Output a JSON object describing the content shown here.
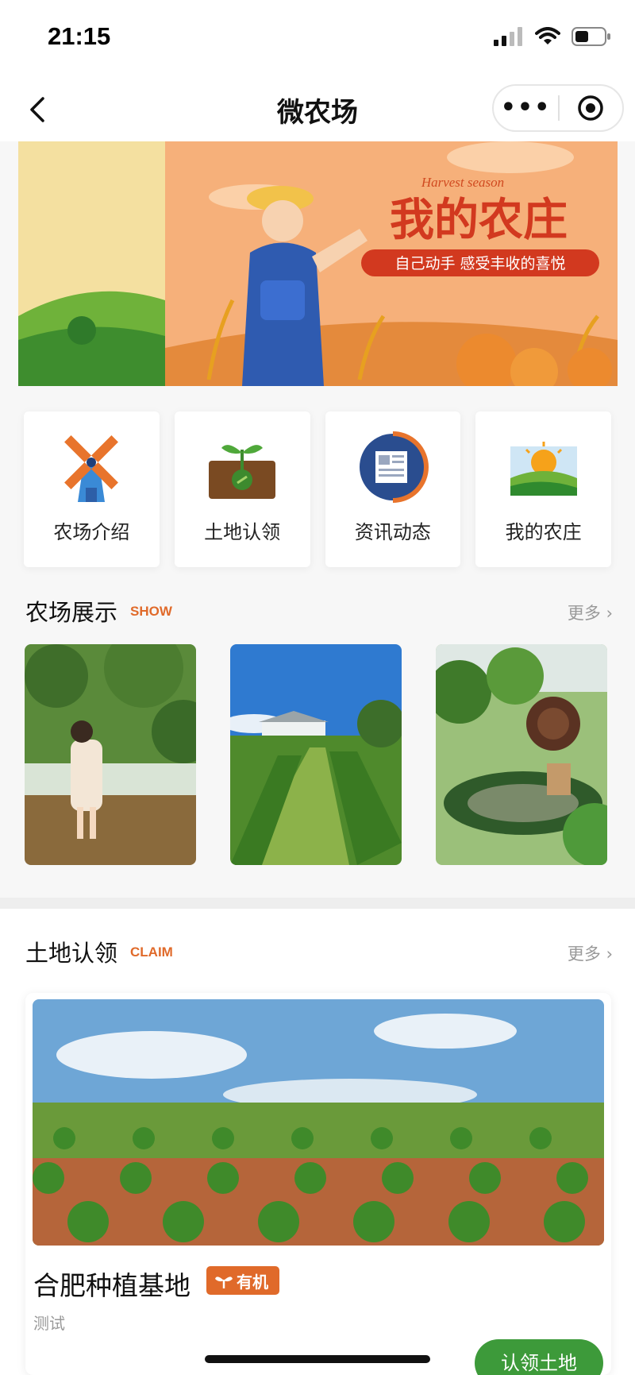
{
  "status_bar": {
    "time": "21:15"
  },
  "navbar": {
    "title": "微农场"
  },
  "banner": {
    "headline": "我的农庄",
    "script_text": "Harvest season",
    "slogan": "自己动手 感受丰收的喜悦"
  },
  "quick_menu": [
    {
      "label": "农场介绍",
      "icon": "windmill-icon"
    },
    {
      "label": "土地认领",
      "icon": "sprout-icon"
    },
    {
      "label": "资讯动态",
      "icon": "news-icon"
    },
    {
      "label": "我的农庄",
      "icon": "sunrise-field-icon"
    }
  ],
  "show_section": {
    "title": "农场展示",
    "tag": "SHOW",
    "more": "更多"
  },
  "claim_section": {
    "title": "土地认领",
    "tag": "CLAIM",
    "more": "更多"
  },
  "land_item": {
    "name": "合肥种植基地",
    "badge": "有机",
    "desc": "测试",
    "button": "认领土地"
  },
  "colors": {
    "accent_orange": "#e06a2a",
    "button_green": "#3d9a3a"
  }
}
